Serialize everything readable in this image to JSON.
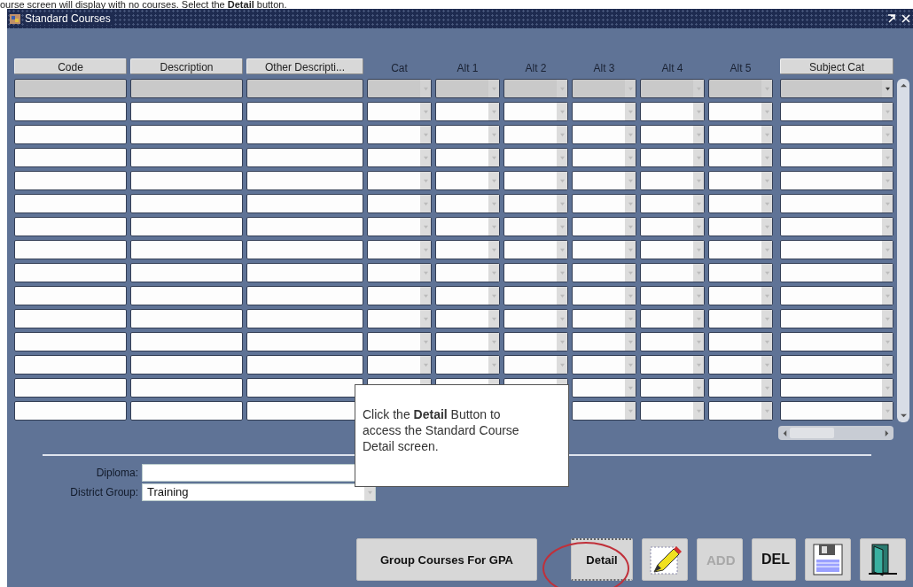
{
  "caption": "ourse screen will display with no courses. Select the **Detail** button.",
  "window": {
    "title": "Standard Courses"
  },
  "table": {
    "columns": [
      {
        "label": "Code",
        "kind": "text"
      },
      {
        "label": "Description",
        "kind": "text"
      },
      {
        "label": "Other Descripti...",
        "kind": "text"
      },
      {
        "label": "Cat",
        "kind": "dropdown"
      },
      {
        "label": "Alt 1",
        "kind": "dropdown"
      },
      {
        "label": "Alt 2",
        "kind": "dropdown"
      },
      {
        "label": "Alt 3",
        "kind": "dropdown"
      },
      {
        "label": "Alt 4",
        "kind": "dropdown"
      },
      {
        "label": "Alt 5",
        "kind": "dropdown"
      },
      {
        "label": "Subject Cat",
        "kind": "lov"
      }
    ],
    "rows": [
      {
        "selected": true
      },
      {
        "selected": false
      },
      {
        "selected": false
      },
      {
        "selected": false
      },
      {
        "selected": false
      },
      {
        "selected": false
      },
      {
        "selected": false
      },
      {
        "selected": false
      },
      {
        "selected": false
      },
      {
        "selected": false
      },
      {
        "selected": false
      },
      {
        "selected": false
      },
      {
        "selected": false
      },
      {
        "selected": false
      },
      {
        "selected": false
      }
    ]
  },
  "form": [
    {
      "label": "Diploma:",
      "kind": "text"
    },
    {
      "label": "District Group:",
      "kind": "dropdown",
      "value": "Training"
    }
  ],
  "callout": {
    "text": "Click the **Detail** Button to access the Standard Course Detail screen."
  },
  "buttons": [
    {
      "kind": "text",
      "label": "Group Courses For GPA",
      "disabled": false,
      "highlighted": false
    },
    {
      "kind": "text",
      "label": "Detail",
      "disabled": false,
      "highlighted": true
    },
    {
      "kind": "edit"
    },
    {
      "kind": "text",
      "label": "ADD",
      "disabled": true,
      "highlighted": false
    },
    {
      "kind": "text",
      "label": "DEL",
      "disabled": false,
      "highlighted": false
    },
    {
      "kind": "save"
    },
    {
      "kind": "exit"
    }
  ]
}
